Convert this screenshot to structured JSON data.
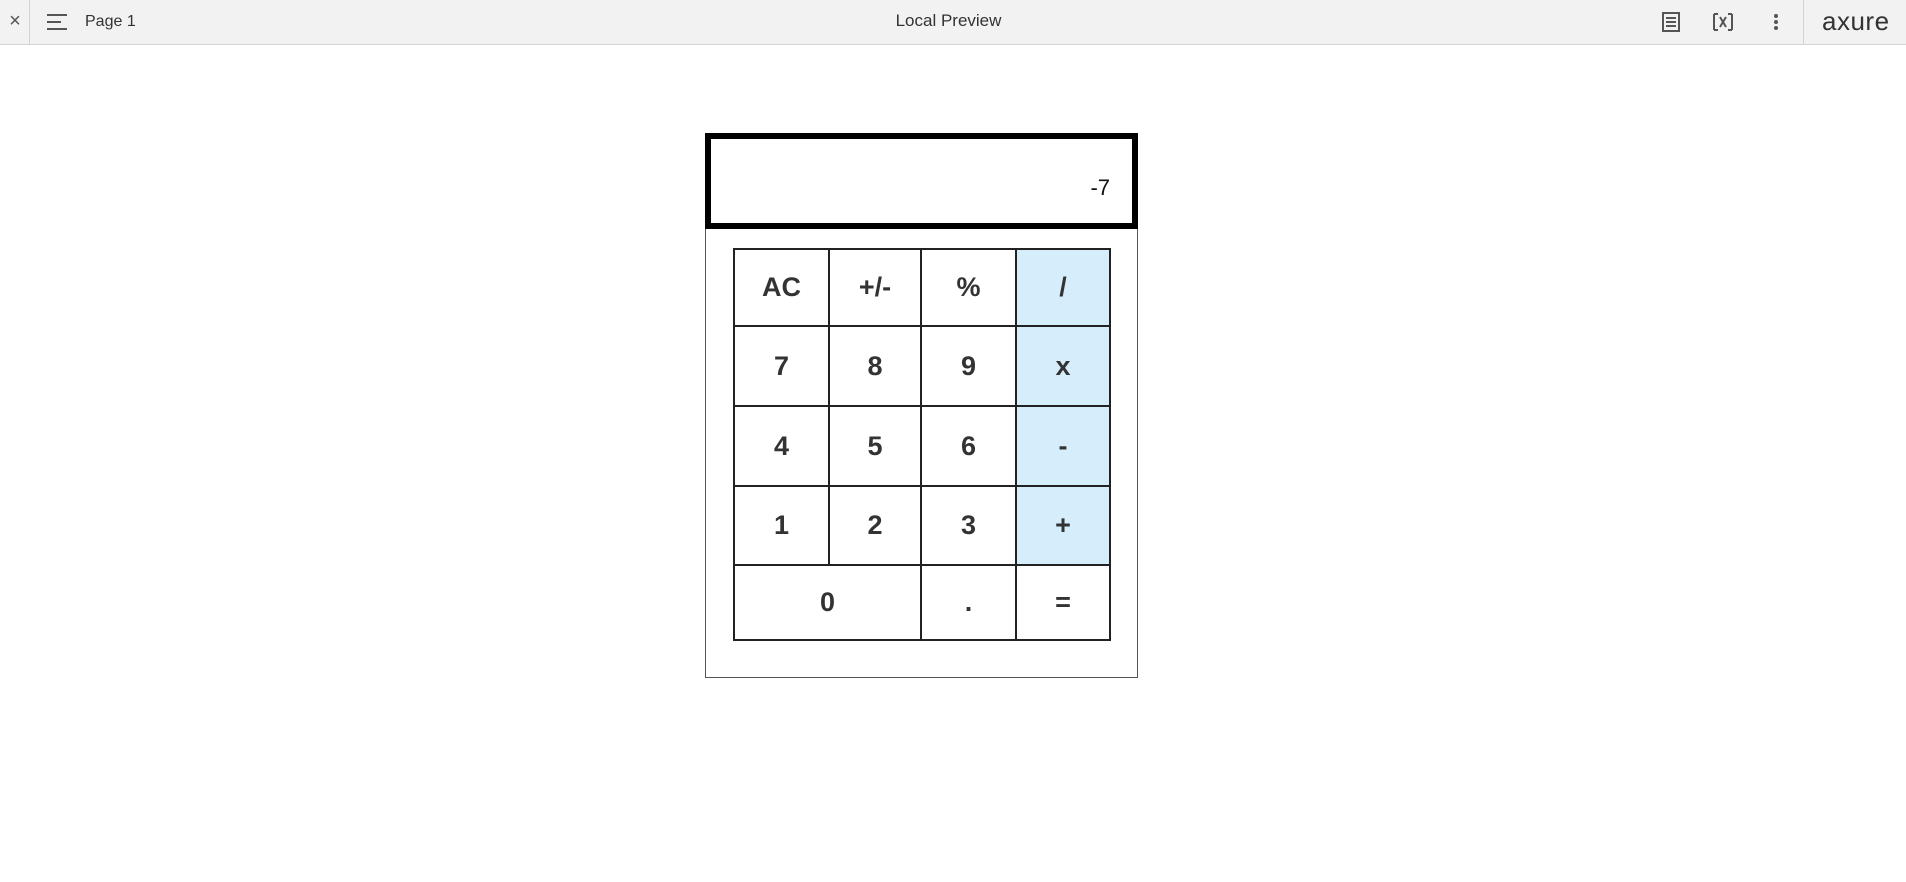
{
  "topbar": {
    "close_glyph": "×",
    "page_label": "Page 1",
    "title": "Local Preview",
    "logo": "axure",
    "icons": [
      "close-icon",
      "hamburger-menu-icon",
      "document-icon",
      "variable-icon",
      "more-vert-icon"
    ]
  },
  "calculator": {
    "display": "-7",
    "keys": {
      "ac": "AC",
      "sign": "+/-",
      "percent": "%",
      "divide": "/",
      "seven": "7",
      "eight": "8",
      "nine": "9",
      "multiply": "x",
      "four": "4",
      "five": "5",
      "six": "6",
      "minus": "-",
      "one": "1",
      "two": "2",
      "three": "3",
      "plus": "+",
      "zero": "0",
      "decimal": ".",
      "equals": "="
    },
    "colors": {
      "operator_bg": "#d6eefb",
      "key_bg": "#ffffff",
      "border": "#222222"
    }
  }
}
